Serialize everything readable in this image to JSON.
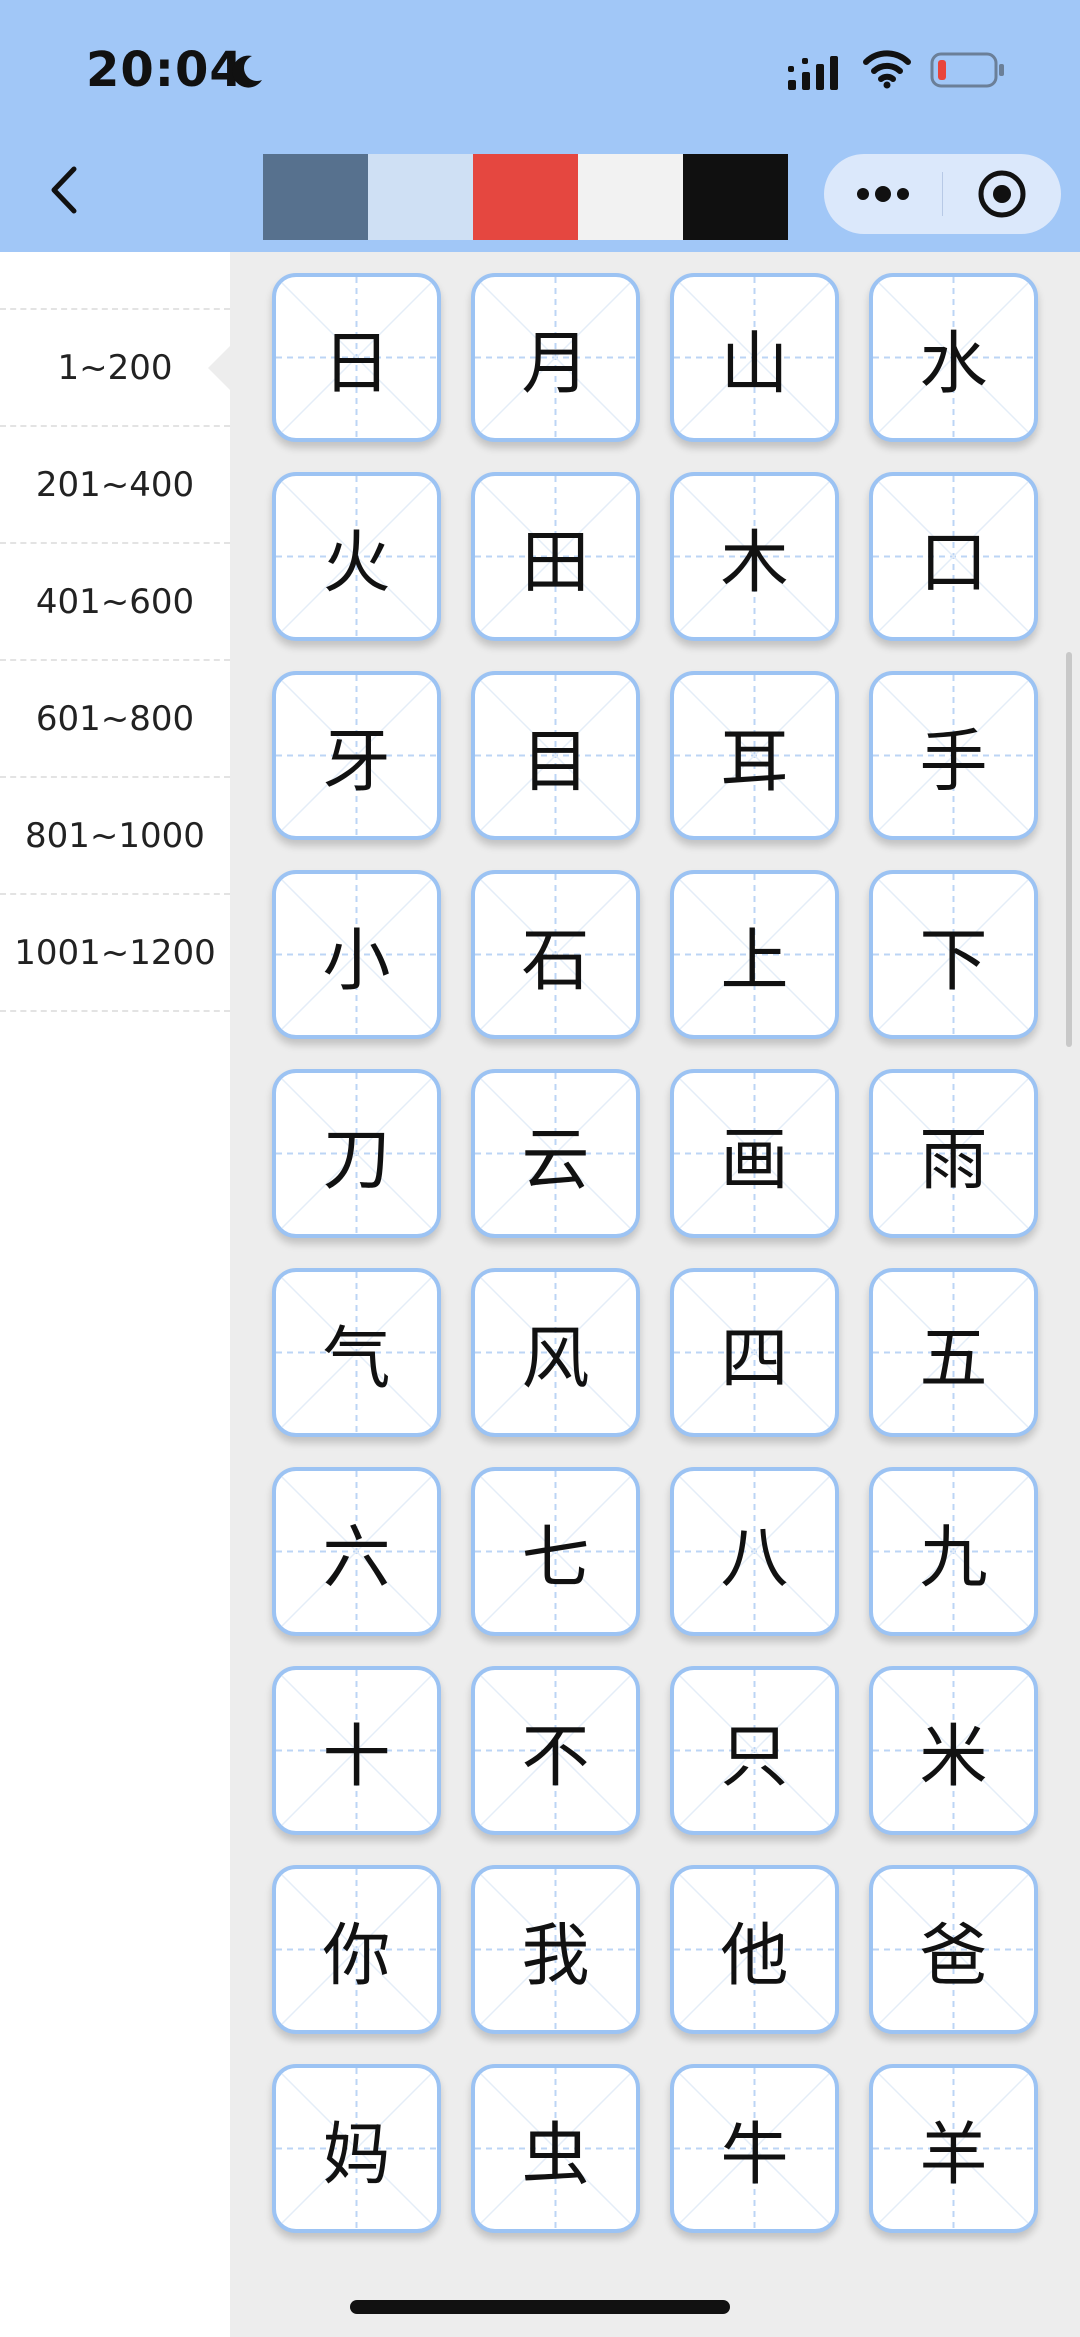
{
  "status_bar": {
    "time": "20:04",
    "icons": [
      "moon-icon",
      "signal-icon",
      "wifi-icon",
      "battery-icon"
    ],
    "battery_color": "#e8453c"
  },
  "header": {
    "back_icon": "chevron-left-icon",
    "palette": [
      "#a1c7f7",
      "#57718e",
      "#cfe0f4",
      "#e54740",
      "#f2f2f2",
      "#101010"
    ],
    "capsule_icons": [
      "more-dots-icon",
      "target-icon"
    ],
    "background_color": "#a1c7f7"
  },
  "sidebar": {
    "items": [
      {
        "label": "1~200",
        "active": true
      },
      {
        "label": "201~400",
        "active": false
      },
      {
        "label": "401~600",
        "active": false
      },
      {
        "label": "601~800",
        "active": false
      },
      {
        "label": "801~1000",
        "active": false
      },
      {
        "label": "1001~1200",
        "active": false
      }
    ]
  },
  "characters": [
    "日",
    "月",
    "山",
    "水",
    "火",
    "田",
    "木",
    "口",
    "牙",
    "目",
    "耳",
    "手",
    "小",
    "石",
    "上",
    "下",
    "刀",
    "云",
    "画",
    "雨",
    "气",
    "风",
    "四",
    "五",
    "六",
    "七",
    "八",
    "九",
    "十",
    "不",
    "只",
    "米",
    "你",
    "我",
    "他",
    "爸",
    "妈",
    "虫",
    "牛",
    "羊"
  ],
  "colors": {
    "card_border": "#9cc3f3",
    "grid_line": "#bcd5f5",
    "background": "#ededed"
  }
}
